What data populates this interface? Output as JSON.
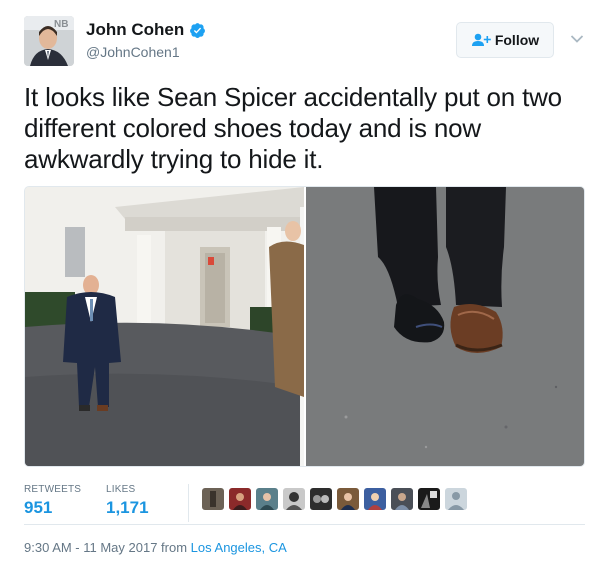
{
  "user": {
    "display_name": "John Cohen",
    "handle": "@JohnCohen1",
    "verified": true,
    "avatar_badge_text": "NB"
  },
  "actions": {
    "follow_label": "Follow",
    "more_icon": "chevron-down-icon"
  },
  "tweet": {
    "text": "It looks like Sean Spicer accidentally put on two different colored shoes today and is now awkwardly trying to hide it."
  },
  "stats": {
    "retweets_label": "RETWEETS",
    "retweets_value": "951",
    "likes_label": "LIKES",
    "likes_value": "1,171",
    "liker_avatar_count": 10
  },
  "footer": {
    "timestamp": "9:30 AM - 11 May 2017 from ",
    "location": "Los Angeles, CA"
  },
  "colors": {
    "link_blue": "#1b95e0",
    "secondary_text": "#657786",
    "border": "#e1e8ed",
    "verified_blue": "#1da1f2"
  }
}
